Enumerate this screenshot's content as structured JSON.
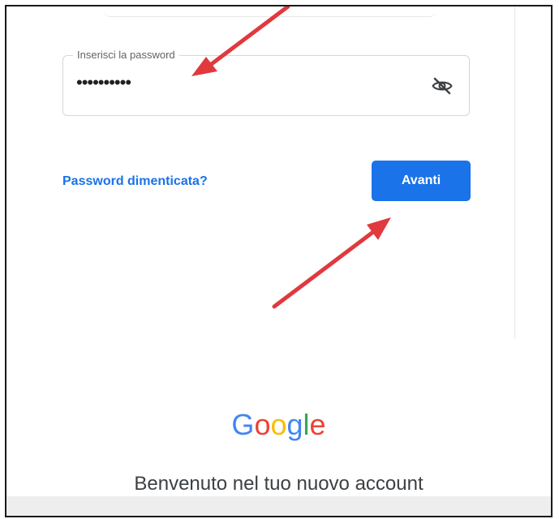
{
  "password_field": {
    "label": "Inserisci la password",
    "masked_value": "••••••••••",
    "toggle_icon": "eye-off-icon"
  },
  "actions": {
    "forgot_link": "Password dimenticata?",
    "next_button": "Avanti"
  },
  "branding": {
    "logo_letters": [
      "G",
      "o",
      "o",
      "g",
      "l",
      "e"
    ],
    "logo_colors": [
      "#4285F4",
      "#EA4335",
      "#FBBC05",
      "#4285F4",
      "#34A853",
      "#EA4335"
    ],
    "welcome_text": "Benvenuto nel tuo nuovo account"
  },
  "colors": {
    "accent": "#1a73e8",
    "annotation_arrow": "#e0393e"
  },
  "annotations": [
    {
      "name": "arrow-to-password-field",
      "icon": "arrow-icon"
    },
    {
      "name": "arrow-to-avanti-button",
      "icon": "arrow-icon"
    }
  ]
}
